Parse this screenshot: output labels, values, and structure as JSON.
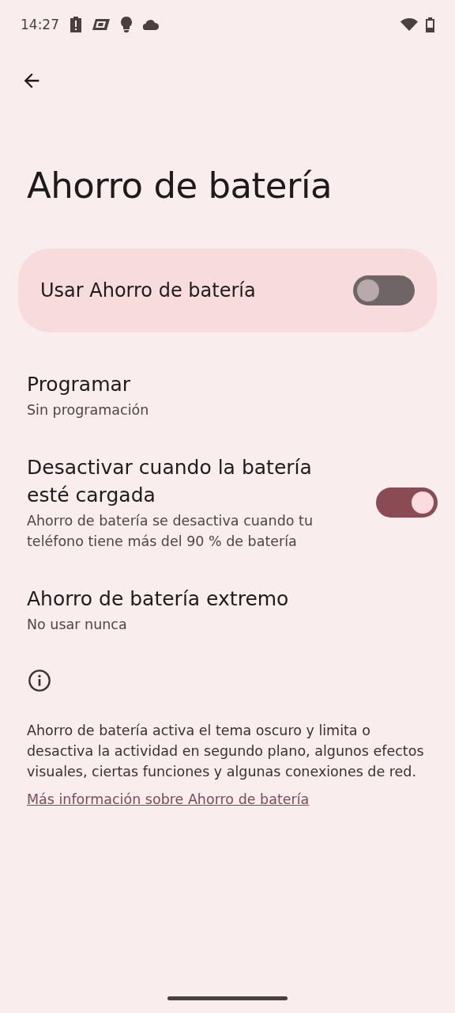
{
  "status_bar": {
    "time": "14:27"
  },
  "title": "Ahorro de batería",
  "main_switch": {
    "label": "Usar Ahorro de batería",
    "on": false
  },
  "items": [
    {
      "kind": "text",
      "title": "Programar",
      "subtitle": "Sin programación"
    },
    {
      "kind": "switch",
      "title": "Desactivar cuando la batería esté cargada",
      "subtitle": "Ahorro de batería se desactiva cuando tu teléfono tiene más del 90 % de batería",
      "on": true
    },
    {
      "kind": "text",
      "title": "Ahorro de batería extremo",
      "subtitle": "No usar nunca"
    }
  ],
  "footer": {
    "text": "Ahorro de batería activa el tema oscuro y limita o desactiva la actividad en segundo plano, algunos efectos visuales, ciertas funciones y algunas conexiones de red.",
    "link": "Más información sobre Ahorro de batería"
  }
}
